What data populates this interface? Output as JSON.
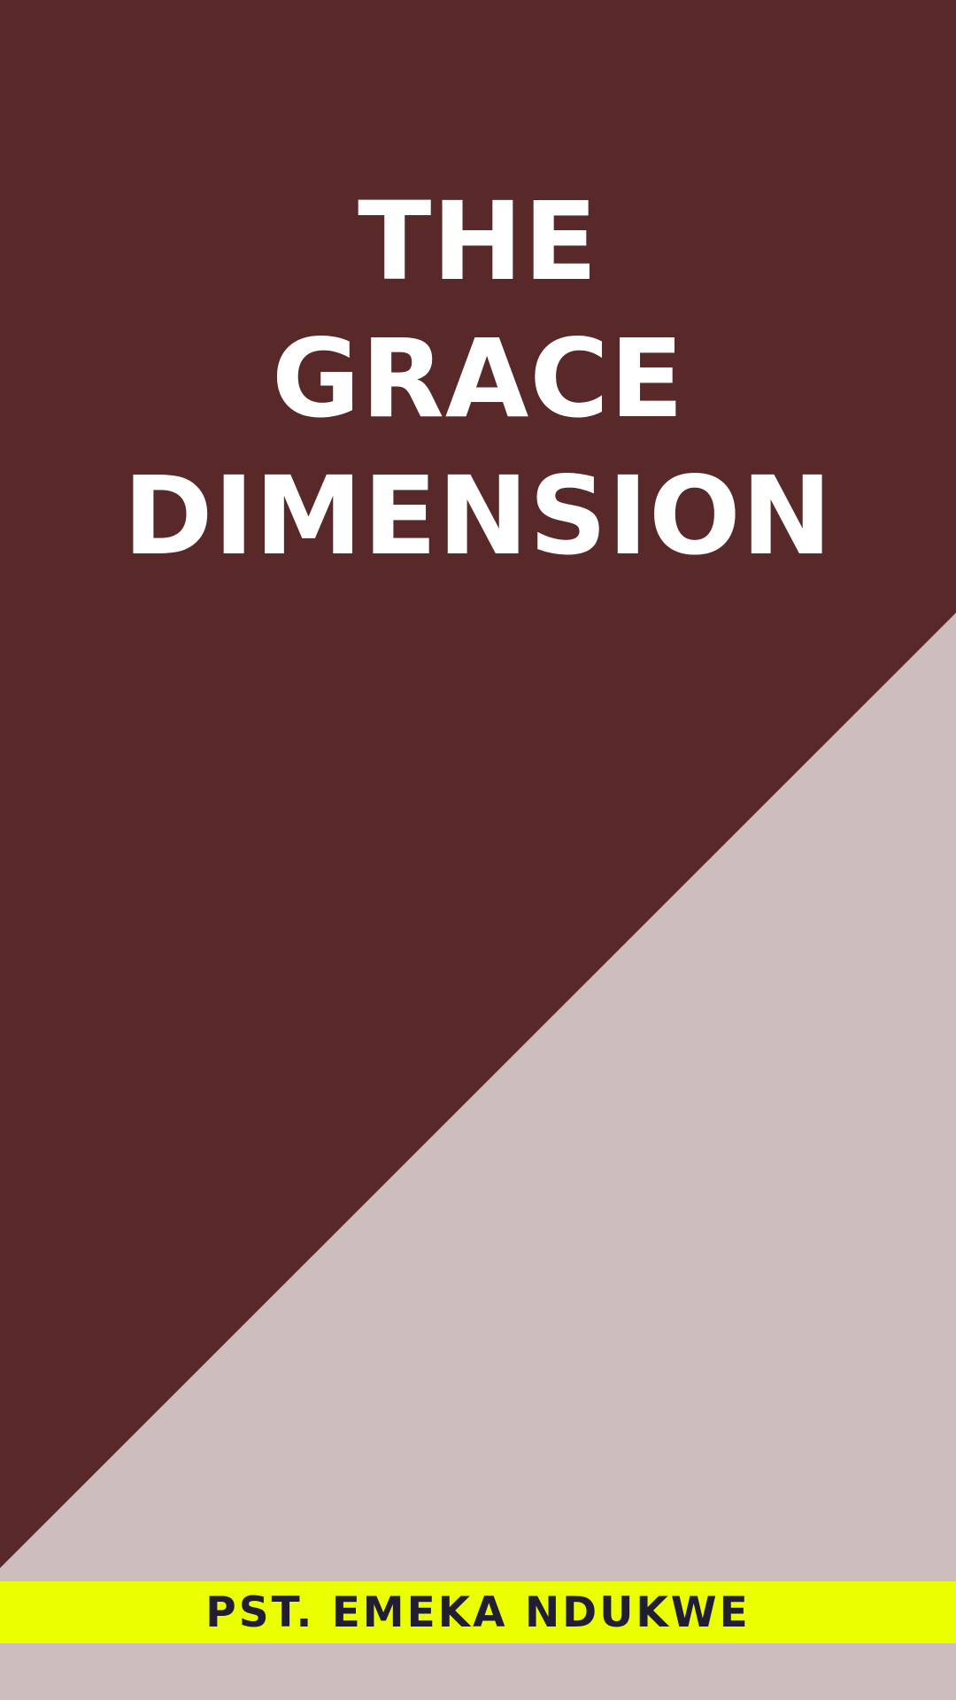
{
  "cover": {
    "title_lines": [
      "THE",
      "GRACE",
      "DIMENSION"
    ],
    "author": "PST. EMEKA NDUKWE"
  },
  "colors": {
    "dark_background": "#59292a",
    "light_background": "#cdbdbd",
    "title_text": "#ffffff",
    "author_band": "#eaff00",
    "author_text": "#211d33"
  }
}
